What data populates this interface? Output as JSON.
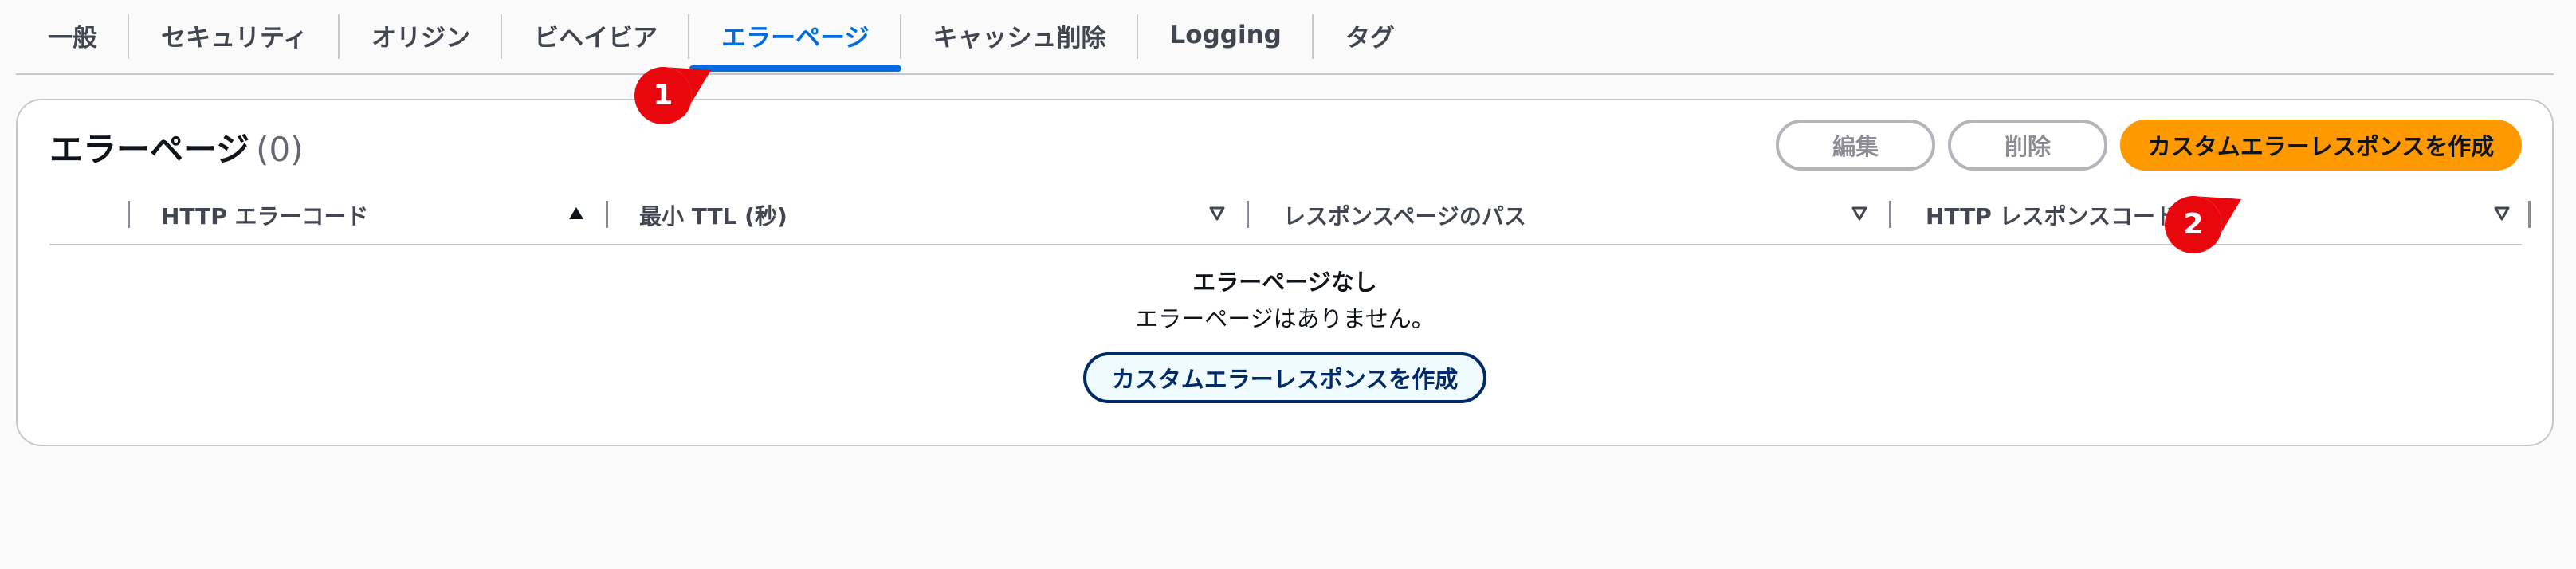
{
  "tabs": [
    {
      "label": "一般",
      "active": false
    },
    {
      "label": "セキュリティ",
      "active": false
    },
    {
      "label": "オリジン",
      "active": false
    },
    {
      "label": "ビヘイビア",
      "active": false
    },
    {
      "label": "エラーページ",
      "active": true
    },
    {
      "label": "キャッシュ削除",
      "active": false
    },
    {
      "label": "Logging",
      "active": false
    },
    {
      "label": "タグ",
      "active": false
    }
  ],
  "panel": {
    "title": "エラーページ",
    "count": "(0)",
    "edit_label": "編集",
    "delete_label": "削除",
    "create_label": "カスタムエラーレスポンスを作成"
  },
  "table": {
    "columns": [
      {
        "label": "HTTP エラーコード",
        "sort": "ascending"
      },
      {
        "label": "最小 TTL (秒)",
        "sort": "none"
      },
      {
        "label": "レスポンスページのパス",
        "sort": "none"
      },
      {
        "label": "HTTP レスポンスコード",
        "sort": "none"
      }
    ]
  },
  "empty_state": {
    "title": "エラーページなし",
    "description": "エラーページはありません。",
    "button_label": "カスタムエラーレスポンスを作成"
  },
  "callouts": [
    {
      "number": "1",
      "color": "#e8070d"
    },
    {
      "number": "2",
      "color": "#e8070d"
    }
  ],
  "colors": {
    "active_tab": "#006ce0",
    "primary_button": "#ff9900",
    "callout": "#e8070d"
  }
}
